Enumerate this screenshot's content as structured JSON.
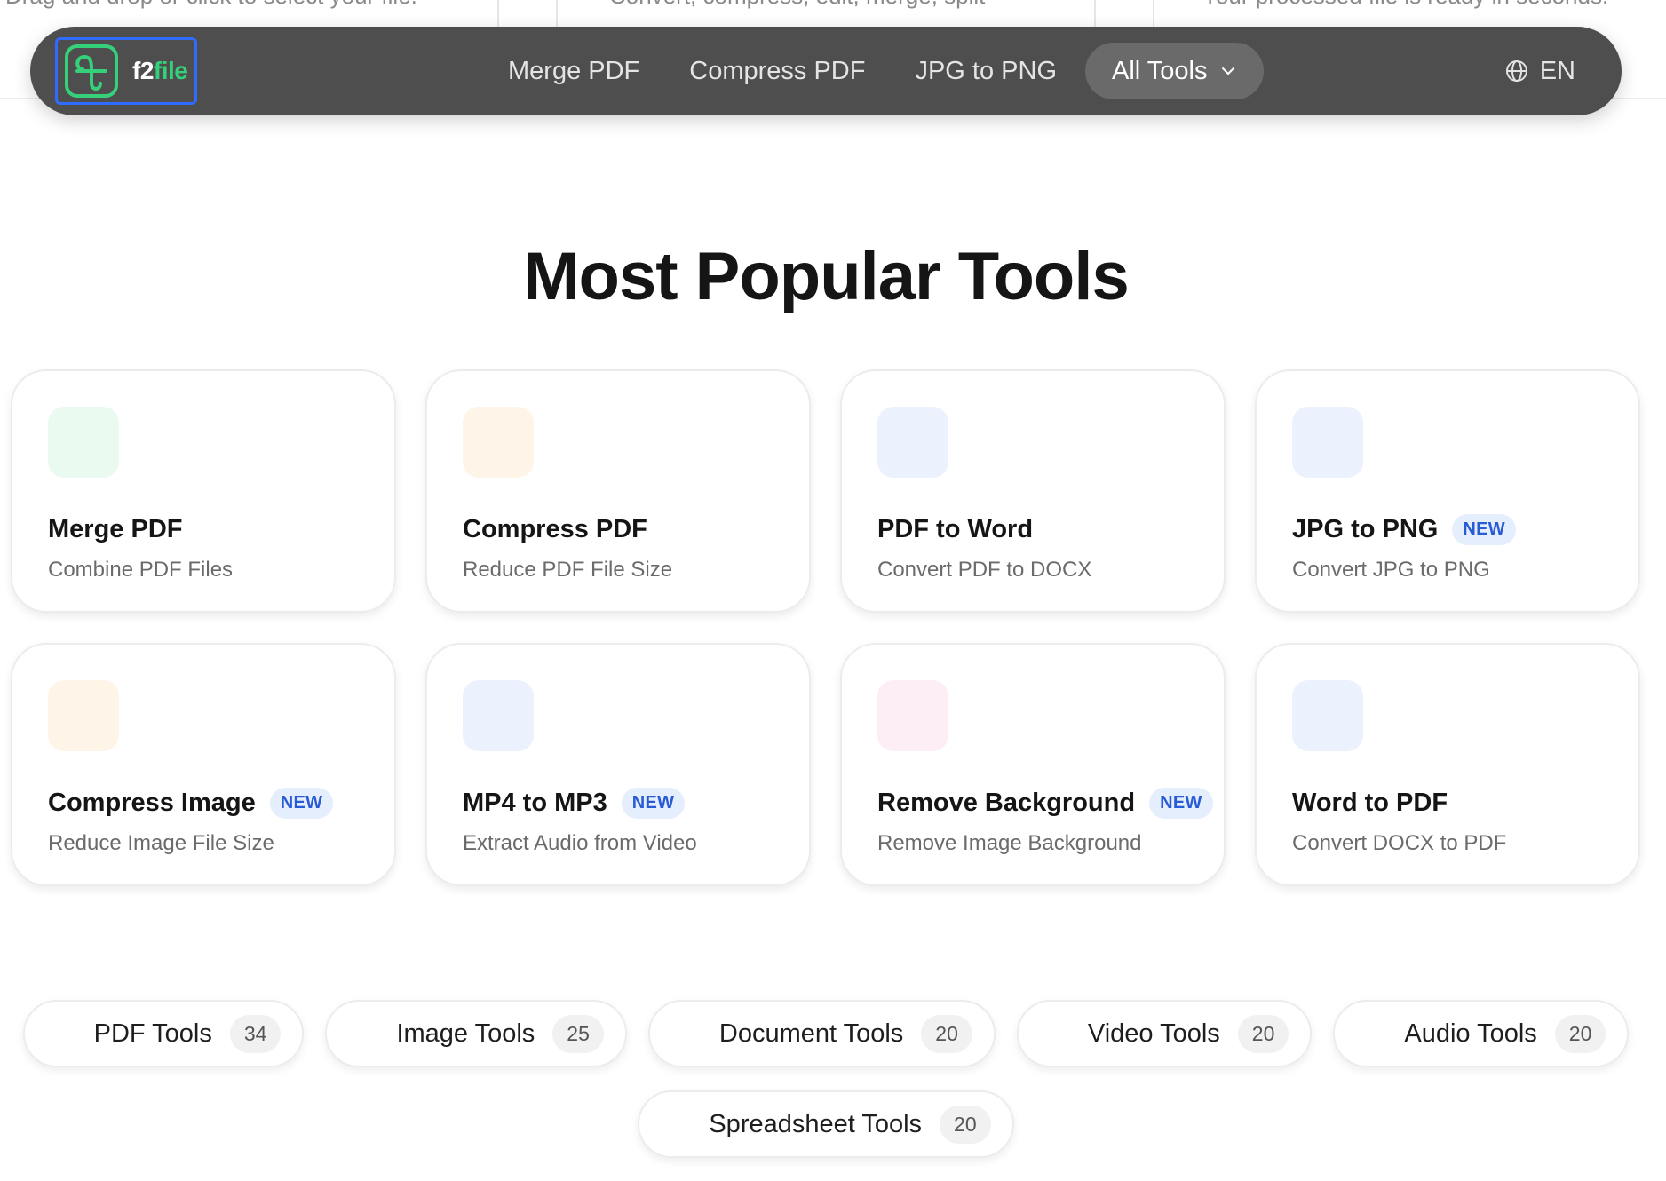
{
  "background_hints": {
    "col1": "Drag and drop or click to select your file.",
    "col2": "Convert, compress, edit, merge, split",
    "col3": "Your processed file is ready in seconds."
  },
  "header": {
    "logo_text_part1": "f2",
    "logo_text_part2": "file",
    "nav": [
      "Merge PDF",
      "Compress PDF",
      "JPG to PNG"
    ],
    "all_tools": "All Tools",
    "language": "EN"
  },
  "section_title": "Most Popular Tools",
  "badge_label": "NEW",
  "cards": [
    {
      "title": "Merge PDF",
      "desc": "Combine PDF Files",
      "icon": "merge-icon",
      "color": "#2ec27e",
      "bg": "#eafaf1",
      "new": false
    },
    {
      "title": "Compress PDF",
      "desc": "Reduce PDF File Size",
      "icon": "compress-file-icon",
      "color": "#f59e2a",
      "bg": "#fff4e8",
      "new": false
    },
    {
      "title": "PDF to Word",
      "desc": "Convert PDF to DOCX",
      "icon": "file-text-icon",
      "color": "#3b6fe0",
      "bg": "#ecf2fd",
      "new": false
    },
    {
      "title": "JPG to PNG",
      "desc": "Convert JPG to PNG",
      "icon": "image-icon",
      "color": "#3b6fe0",
      "bg": "#ecf2fd",
      "new": true
    },
    {
      "title": "Compress Image",
      "desc": "Reduce Image File Size",
      "icon": "compress-file-icon",
      "color": "#f59e2a",
      "bg": "#fff4e8",
      "new": true
    },
    {
      "title": "MP4 to MP3",
      "desc": "Extract Audio from Video",
      "icon": "music-icon",
      "color": "#3b6fe0",
      "bg": "#ecf2fd",
      "new": true
    },
    {
      "title": "Remove Background",
      "desc": "Remove Image Background",
      "icon": "eraser-icon",
      "color": "#e74694",
      "bg": "#fdeef5",
      "new": true
    },
    {
      "title": "Word to PDF",
      "desc": "Convert DOCX to PDF",
      "icon": "file-import-icon",
      "color": "#3b6fe0",
      "bg": "#ecf2fd",
      "new": false
    }
  ],
  "categories": [
    {
      "label": "PDF Tools",
      "count": "34",
      "icon": "pdf-file-icon",
      "color": "#e5484d"
    },
    {
      "label": "Image Tools",
      "count": "25",
      "icon": "image-icon",
      "color": "#3b6fe0"
    },
    {
      "label": "Document Tools",
      "count": "20",
      "icon": "document-icon",
      "color": "#7c4ddb"
    },
    {
      "label": "Video Tools",
      "count": "20",
      "icon": "video-icon",
      "color": "#f59e2a"
    },
    {
      "label": "Audio Tools",
      "count": "20",
      "icon": "music-icon",
      "color": "#e74694"
    },
    {
      "label": "Spreadsheet Tools",
      "count": "20",
      "icon": "spreadsheet-icon",
      "color": "#2ec27e"
    }
  ]
}
